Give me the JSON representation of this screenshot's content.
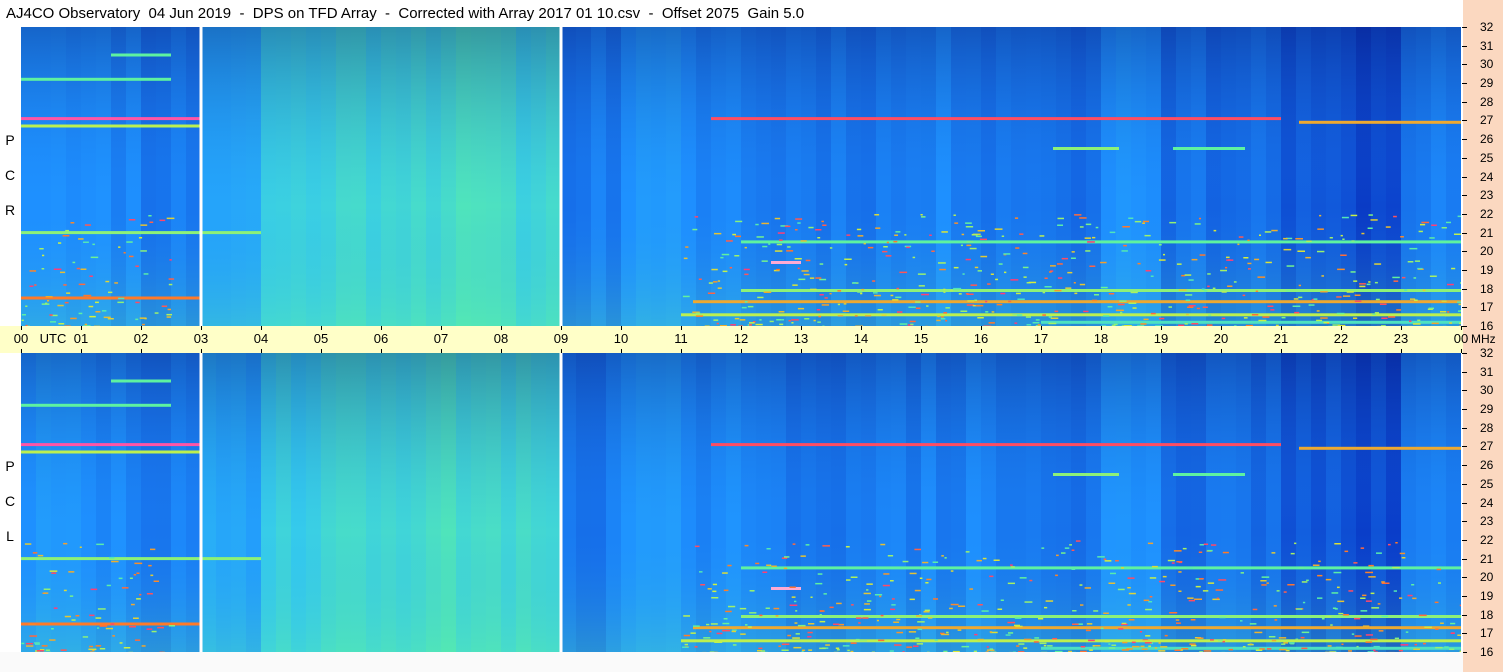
{
  "title": "AJ4CO Observatory  04 Jun 2019  -  DPS on TFD Array  -  Corrected with Array 2017 01 10.csv  -  Offset 2075  Gain 5.0",
  "chart_data": [
    {
      "type": "heatmap",
      "panel": "RCP",
      "side_label": [
        "R",
        "C",
        "P"
      ],
      "x_unit": "UTC",
      "x_ticks": [
        "00",
        "01",
        "02",
        "03",
        "04",
        "05",
        "06",
        "07",
        "08",
        "09",
        "10",
        "11",
        "12",
        "13",
        "14",
        "15",
        "16",
        "17",
        "18",
        "19",
        "20",
        "21",
        "22",
        "23",
        "00"
      ],
      "y_unit": "MHz",
      "y_ticks": [
        16,
        17,
        18,
        19,
        20,
        21,
        22,
        23,
        24,
        25,
        26,
        27,
        28,
        29,
        30,
        31,
        32
      ],
      "ylim": [
        16,
        32
      ],
      "xlim_hours": [
        0,
        24
      ],
      "colormap": [
        "#06125c",
        "#0a3cc8",
        "#1e90ff",
        "#33c8f0",
        "#5ef2a0",
        "#d4f03c",
        "#ff7a28",
        "#ff2a90",
        "#ffffff"
      ],
      "gaps_utc": [
        3.0,
        9.0
      ]
    },
    {
      "type": "heatmap",
      "panel": "LCP",
      "side_label": [
        "L",
        "C",
        "P"
      ],
      "x_unit": "UTC",
      "x_ticks": [
        "00",
        "01",
        "02",
        "03",
        "04",
        "05",
        "06",
        "07",
        "08",
        "09",
        "10",
        "11",
        "12",
        "13",
        "14",
        "15",
        "16",
        "17",
        "18",
        "19",
        "20",
        "21",
        "22",
        "23",
        "00"
      ],
      "y_unit": "MHz",
      "y_ticks": [
        16,
        17,
        18,
        19,
        20,
        21,
        22,
        23,
        24,
        25,
        26,
        27,
        28,
        29,
        30,
        31,
        32
      ],
      "ylim": [
        16,
        32
      ],
      "xlim_hours": [
        0,
        24
      ],
      "colormap": [
        "#06125c",
        "#0a3cc8",
        "#1e90ff",
        "#33c8f0",
        "#5ef2a0",
        "#d4f03c",
        "#ff7a28",
        "#ff2a90",
        "#ffffff"
      ],
      "gaps_utc": [
        3.0,
        9.0
      ]
    }
  ],
  "colors": {
    "axis_band": "#ffffc8",
    "freq_column": "#fbd8c0"
  }
}
